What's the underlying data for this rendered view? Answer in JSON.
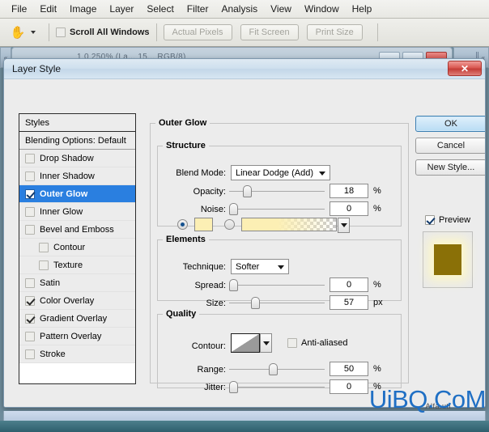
{
  "app": {
    "menubar": [
      "File",
      "Edit",
      "Image",
      "Layer",
      "Select",
      "Filter",
      "Analysis",
      "View",
      "Window",
      "Help"
    ],
    "options_bar": {
      "tool_icon": "hand-tool-icon",
      "scroll_all_windows_label": "Scroll All Windows",
      "scroll_all_windows_checked": false,
      "buttons": [
        "Actual Pixels",
        "Fit Screen",
        "Print Size"
      ]
    },
    "document_title": "1.0 250% (La...   15...   RGB/8)",
    "watermark": "UiBQ.CoM",
    "watermark_sub": "Alfa.utl"
  },
  "dialog": {
    "title": "Layer Style",
    "close_label": "✕",
    "styles_panel": {
      "header": "Styles",
      "blending_options": "Blending Options: Default",
      "effects": [
        {
          "label": "Drop Shadow",
          "checked": false,
          "selected": false,
          "indent": false
        },
        {
          "label": "Inner Shadow",
          "checked": false,
          "selected": false,
          "indent": false
        },
        {
          "label": "Outer Glow",
          "checked": true,
          "selected": true,
          "indent": false
        },
        {
          "label": "Inner Glow",
          "checked": false,
          "selected": false,
          "indent": false
        },
        {
          "label": "Bevel and Emboss",
          "checked": false,
          "selected": false,
          "indent": false
        },
        {
          "label": "Contour",
          "checked": false,
          "selected": false,
          "indent": true
        },
        {
          "label": "Texture",
          "checked": false,
          "selected": false,
          "indent": true
        },
        {
          "label": "Satin",
          "checked": false,
          "selected": false,
          "indent": false
        },
        {
          "label": "Color Overlay",
          "checked": true,
          "selected": false,
          "indent": false
        },
        {
          "label": "Gradient Overlay",
          "checked": true,
          "selected": false,
          "indent": false
        },
        {
          "label": "Pattern Overlay",
          "checked": false,
          "selected": false,
          "indent": false
        },
        {
          "label": "Stroke",
          "checked": false,
          "selected": false,
          "indent": false
        }
      ]
    },
    "panel_title": "Outer Glow",
    "structure": {
      "legend": "Structure",
      "blend_mode_label": "Blend Mode:",
      "blend_mode_value": "Linear Dodge (Add)",
      "opacity_label": "Opacity:",
      "opacity_value": "18",
      "opacity_unit": "%",
      "noise_label": "Noise:",
      "noise_value": "0",
      "noise_unit": "%",
      "fill_type": "color",
      "color_hex": "#fcefb4",
      "gradient_start_hex": "#fcefb4"
    },
    "elements": {
      "legend": "Elements",
      "technique_label": "Technique:",
      "technique_value": "Softer",
      "spread_label": "Spread:",
      "spread_value": "0",
      "spread_unit": "%",
      "size_label": "Size:",
      "size_value": "57",
      "size_unit": "px"
    },
    "quality": {
      "legend": "Quality",
      "contour_label": "Contour:",
      "contour_preset": "linear-contour-icon",
      "anti_aliased_label": "Anti-aliased",
      "anti_aliased_checked": false,
      "range_label": "Range:",
      "range_value": "50",
      "range_unit": "%",
      "jitter_label": "Jitter:",
      "jitter_value": "0",
      "jitter_unit": "%"
    },
    "buttons": {
      "ok": "OK",
      "cancel": "Cancel",
      "new_style": "New Style...",
      "preview_label": "Preview",
      "preview_checked": true,
      "preview_swatch_hex": "#8a7007",
      "preview_glow_hex": "#fdf8c9"
    }
  }
}
